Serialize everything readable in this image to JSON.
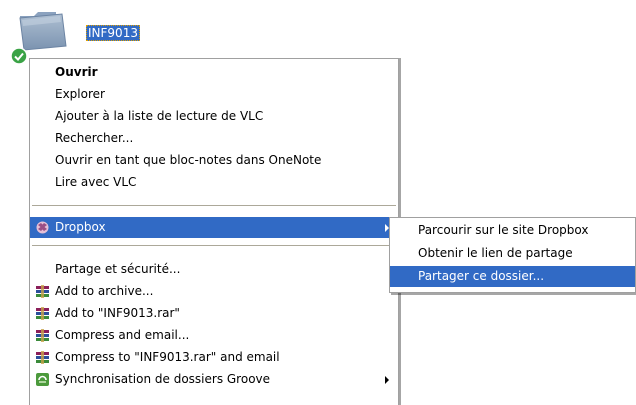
{
  "desktop": {
    "folder_name": "INF9013",
    "folder_icon": "folder-icon",
    "sync_status_icon": "green-check-icon"
  },
  "context_menu": {
    "open": "Ouvrir",
    "explore": "Explorer",
    "vlc_playlist": "Ajouter à la liste de lecture de VLC",
    "search": "Rechercher...",
    "onenote": "Ouvrir en tant que bloc-notes dans OneNote",
    "vlc_play": "Lire avec VLC",
    "dropbox": "Dropbox",
    "sharing_security": "Partage et sécurité...",
    "add_archive": "Add to archive...",
    "add_rar": "Add to \"INF9013.rar\"",
    "compress_email": "Compress and email...",
    "compress_rar_email": "Compress to \"INF9013.rar\" and email",
    "groove_sync": "Synchronisation de dossiers Groove"
  },
  "dropbox_submenu": {
    "browse": "Parcourir sur le site Dropbox",
    "get_link": "Obtenir le lien de partage",
    "share_folder": "Partager ce dossier..."
  },
  "colors": {
    "highlight": "#316ac5",
    "separator": "#aca899"
  }
}
